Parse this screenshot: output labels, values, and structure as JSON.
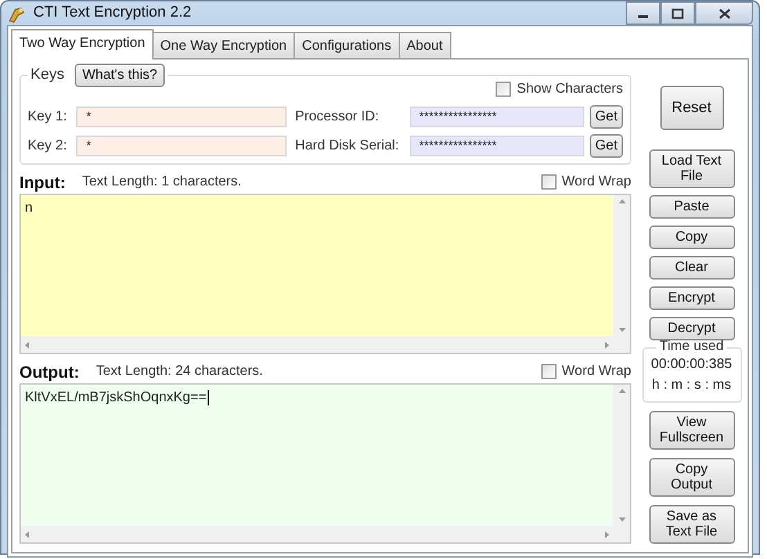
{
  "window": {
    "title": "CTI Text Encryption 2.2"
  },
  "tabs": [
    {
      "label": "Two Way Encryption",
      "selected": true
    },
    {
      "label": "One Way Encryption",
      "selected": false
    },
    {
      "label": "Configurations",
      "selected": false
    },
    {
      "label": "About",
      "selected": false
    }
  ],
  "keys": {
    "legend": "Keys",
    "help_button": "What's this?",
    "show_characters": {
      "label": "Show Characters",
      "checked": false
    },
    "rows": [
      {
        "label": "Key 1:",
        "value": "*",
        "hw_label": "Processor ID:",
        "hw_value": "****************",
        "button": "Get"
      },
      {
        "label": "Key 2:",
        "value": "*",
        "hw_label": "Hard Disk Serial:",
        "hw_value": "****************",
        "button": "Get"
      }
    ]
  },
  "reset_button": "Reset",
  "input": {
    "label": "Input:",
    "length": "Text Length: 1 characters.",
    "word_wrap": {
      "label": "Word Wrap",
      "checked": false
    },
    "text": "n",
    "cursor": false
  },
  "output": {
    "label": "Output:",
    "length": "Text Length: 24 characters.",
    "word_wrap": {
      "label": "Word Wrap",
      "checked": false
    },
    "text": "KltVxEL/mB7jskShOqnxKg==",
    "cursor": true
  },
  "action_buttons": [
    "Load Text File",
    "Paste",
    "Copy",
    "Clear",
    "Encrypt",
    "Decrypt"
  ],
  "time_used": {
    "legend": "Time used",
    "value": "00:00:00:385",
    "units": "h : m : s : ms"
  },
  "output_buttons": [
    "View Fullscreen",
    "Copy Output",
    "Save as Text File"
  ]
}
